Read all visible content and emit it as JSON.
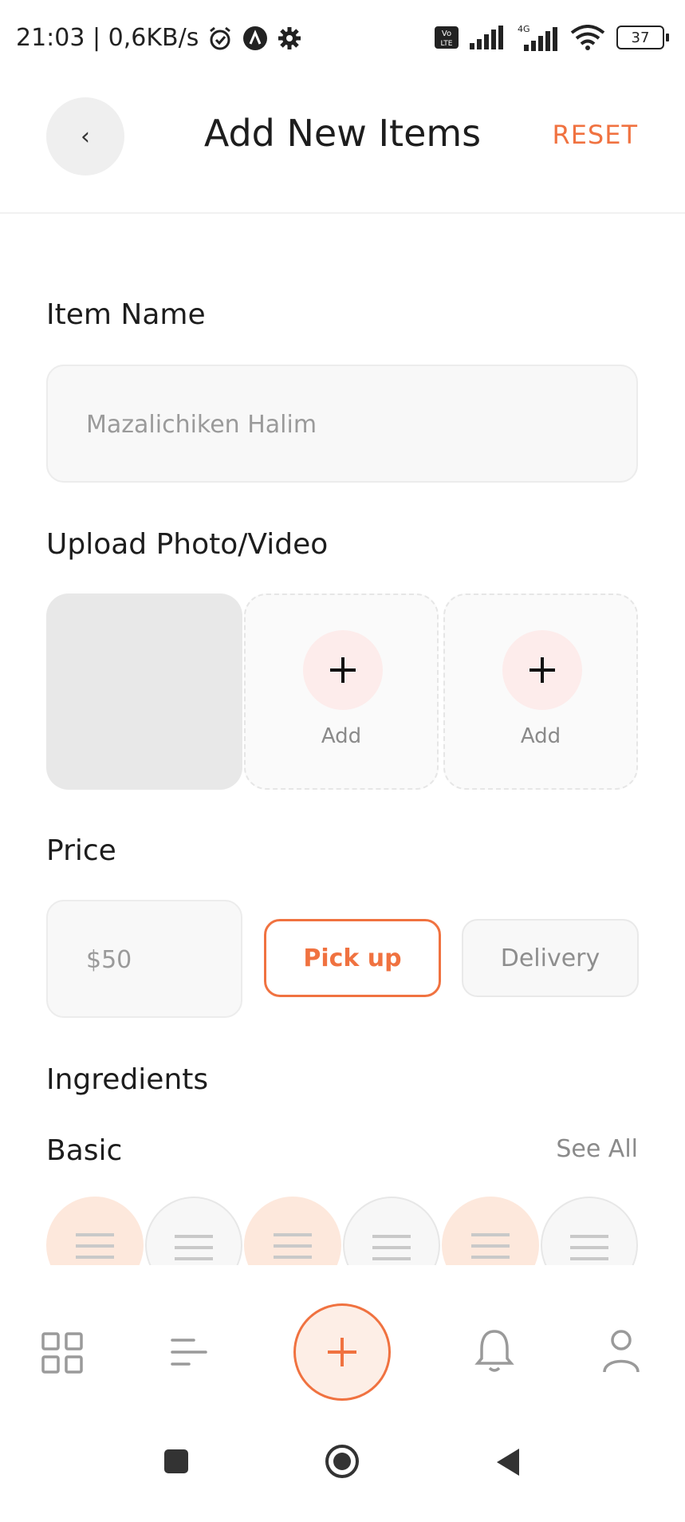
{
  "status": {
    "time_net": "21:03 | 0,6KB/s",
    "battery": "37",
    "network_label": "4G",
    "volte_label": "Vo LTE"
  },
  "header": {
    "title": "Add New Items",
    "reset_label": "RESET",
    "back_glyph": "‹"
  },
  "form": {
    "item_name_label": "Item Name",
    "item_name_value": "Mazalichiken Halim",
    "upload_label": "Upload Photo/Video",
    "upload_slots": [
      {
        "label": "Add"
      },
      {
        "label": "Add"
      }
    ],
    "price_label": "Price",
    "price_value": "$50",
    "pickup_label": "Pick up",
    "delivery_label": "Delivery",
    "selected_option": "Pick up",
    "ingredients_label": "Ingredients",
    "basic_label": "Basic",
    "see_all_label": "See All"
  },
  "ingredients": [
    {
      "style": "orange"
    },
    {
      "style": "gray"
    },
    {
      "style": "orange"
    },
    {
      "style": "gray"
    },
    {
      "style": "orange"
    },
    {
      "style": "gray"
    }
  ],
  "bottom_nav": [
    "grid-icon",
    "menu-icon",
    "add-icon",
    "bell-icon",
    "user-icon"
  ],
  "colors": {
    "accent": "#f07240",
    "accent_light": "#fdeee6",
    "input_bg": "#f8f8f8",
    "muted_text": "#8a8a8a"
  }
}
